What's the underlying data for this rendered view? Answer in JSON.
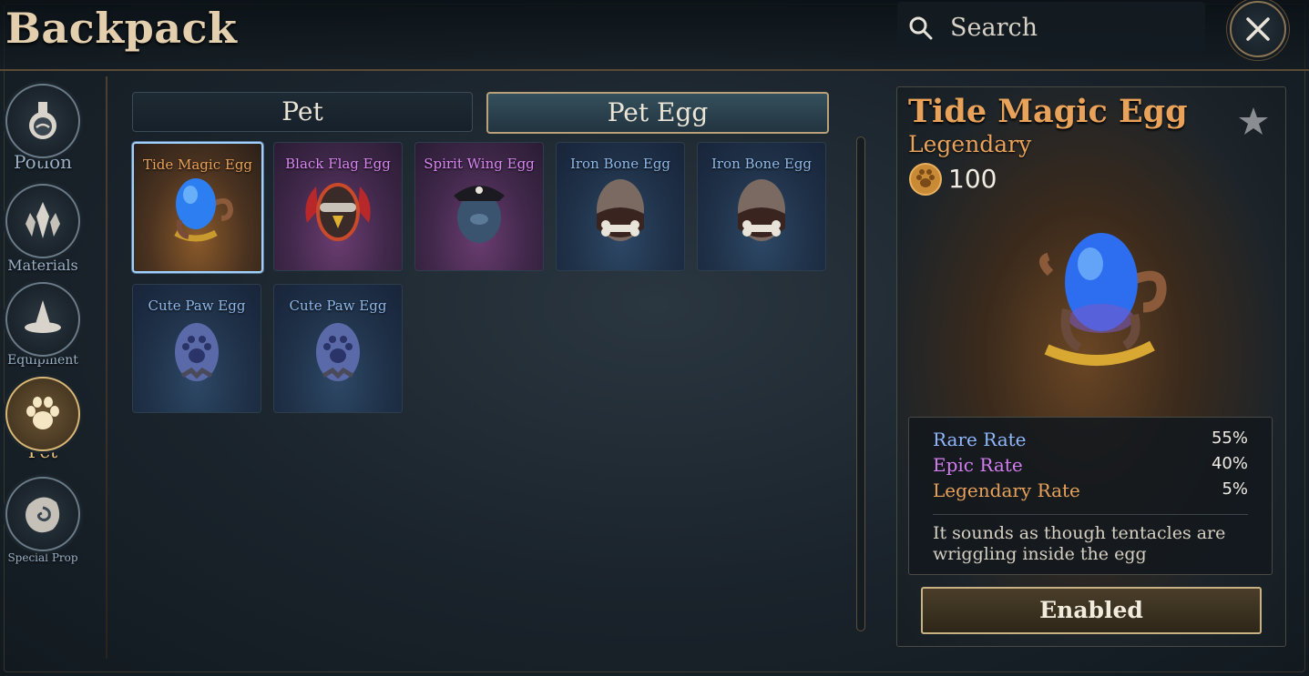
{
  "header": {
    "title": "Backpack",
    "search_placeholder": "Search"
  },
  "sidebar": {
    "items": [
      {
        "label": "Potion",
        "icon": "potion-flask-icon",
        "active": false
      },
      {
        "label": "Materials",
        "icon": "crystals-icon",
        "active": false
      },
      {
        "label": "Equipment",
        "icon": "wizard-hat-icon",
        "active": false
      },
      {
        "label": "Pet",
        "icon": "paw-icon",
        "active": true
      },
      {
        "label": "Special Prop",
        "icon": "swirl-stone-icon",
        "active": false
      }
    ]
  },
  "tabs": [
    {
      "label": "Pet",
      "active": false
    },
    {
      "label": "Pet Egg",
      "active": true
    }
  ],
  "items": [
    {
      "name": "Tide Magic Egg",
      "rarity": "legendary",
      "name_color": "#e8a25a",
      "selected": true
    },
    {
      "name": "Black Flag Egg",
      "rarity": "epic",
      "name_color": "#d987f0"
    },
    {
      "name": "Spirit Wing Egg",
      "rarity": "epic",
      "name_color": "#d987f0"
    },
    {
      "name": "Iron Bone Egg",
      "rarity": "rare",
      "name_color": "#8fb8e8"
    },
    {
      "name": "Iron Bone Egg",
      "rarity": "rare",
      "name_color": "#8fb8e8"
    },
    {
      "name": "Cute Paw Egg",
      "rarity": "rare",
      "name_color": "#8fb8e8"
    },
    {
      "name": "Cute Paw Egg",
      "rarity": "rare",
      "name_color": "#8fb8e8"
    }
  ],
  "detail": {
    "title": "Tide Magic Egg",
    "rarity": "Legendary",
    "price": "100",
    "stats": [
      {
        "label": "Rare Rate",
        "value": "55%",
        "color": "#8fb8ff"
      },
      {
        "label": "Epic Rate",
        "value": "40%",
        "color": "#d27ef0"
      },
      {
        "label": "Legendary Rate",
        "value": "5%",
        "color": "#e8a25a"
      }
    ],
    "description": "It sounds as though tentacles are wriggling inside the egg",
    "button_label": "Enabled"
  }
}
